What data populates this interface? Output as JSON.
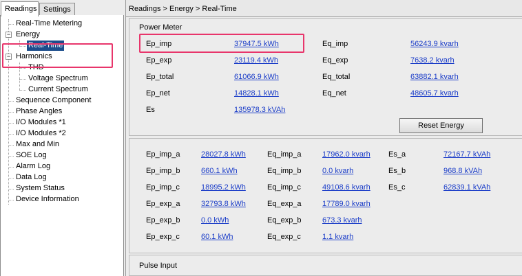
{
  "tabs": {
    "readings": "Readings",
    "settings": "Settings"
  },
  "tree": {
    "items": [
      {
        "label": "Real-Time Metering"
      },
      {
        "label": "Energy"
      },
      {
        "label": "Real-Time"
      },
      {
        "label": "Harmonics"
      },
      {
        "label": "THD"
      },
      {
        "label": "Voltage Spectrum"
      },
      {
        "label": "Current Spectrum"
      },
      {
        "label": "Sequence Component"
      },
      {
        "label": "Phase Angles"
      },
      {
        "label": "I/O Modules *1"
      },
      {
        "label": "I/O Modules *2"
      },
      {
        "label": "Max and Min"
      },
      {
        "label": "SOE Log"
      },
      {
        "label": "Alarm Log"
      },
      {
        "label": "Data Log"
      },
      {
        "label": "System Status"
      },
      {
        "label": "Device Information"
      }
    ]
  },
  "breadcrumb": "Readings > Energy > Real-Time",
  "power_meter": {
    "title": "Power Meter",
    "rows": [
      {
        "l1": "Ep_imp",
        "v1": "37947.5 kWh",
        "l2": "Eq_imp",
        "v2": "56243.9 kvarh"
      },
      {
        "l1": "Ep_exp",
        "v1": "23119.4 kWh",
        "l2": "Eq_exp",
        "v2": "7638.2 kvarh"
      },
      {
        "l1": "Ep_total",
        "v1": "61066.9 kWh",
        "l2": "Eq_total",
        "v2": "63882.1 kvarh"
      },
      {
        "l1": "Ep_net",
        "v1": "14828.1 kWh",
        "l2": "Eq_net",
        "v2": "48605.7 kvarh"
      },
      {
        "l1": "Es",
        "v1": "135978.3 kVAh"
      }
    ],
    "reset_label": "Reset Energy"
  },
  "phase_detail": {
    "rows": [
      {
        "l1": "Ep_imp_a",
        "v1": "28027.8 kWh",
        "l2": "Eq_imp_a",
        "v2": "17962.0 kvarh",
        "l3": "Es_a",
        "v3": "72167.7 kVAh"
      },
      {
        "l1": "Ep_imp_b",
        "v1": "660.1 kWh",
        "l2": "Eq_imp_b",
        "v2": "0.0 kvarh",
        "l3": "Es_b",
        "v3": "968.8 kVAh"
      },
      {
        "l1": "Ep_imp_c",
        "v1": "18995.2 kWh",
        "l2": "Eq_imp_c",
        "v2": "49108.6 kvarh",
        "l3": "Es_c",
        "v3": "62839.1 kVAh"
      },
      {
        "l1": "Ep_exp_a",
        "v1": "32793.8 kWh",
        "l2": "Eq_exp_a",
        "v2": "17789.0 kvarh"
      },
      {
        "l1": "Ep_exp_b",
        "v1": "0.0 kWh",
        "l2": "Eq_exp_b",
        "v2": "673.3 kvarh"
      },
      {
        "l1": "Ep_exp_c",
        "v1": "60.1 kWh",
        "l2": "Eq_exp_c",
        "v2": "1.1 kvarh"
      }
    ]
  },
  "pulse_input": {
    "title": "Pulse Input"
  },
  "colors": {
    "link": "#1a3cc8",
    "highlight": "#e8356b",
    "selected": "#1c4d8c"
  }
}
